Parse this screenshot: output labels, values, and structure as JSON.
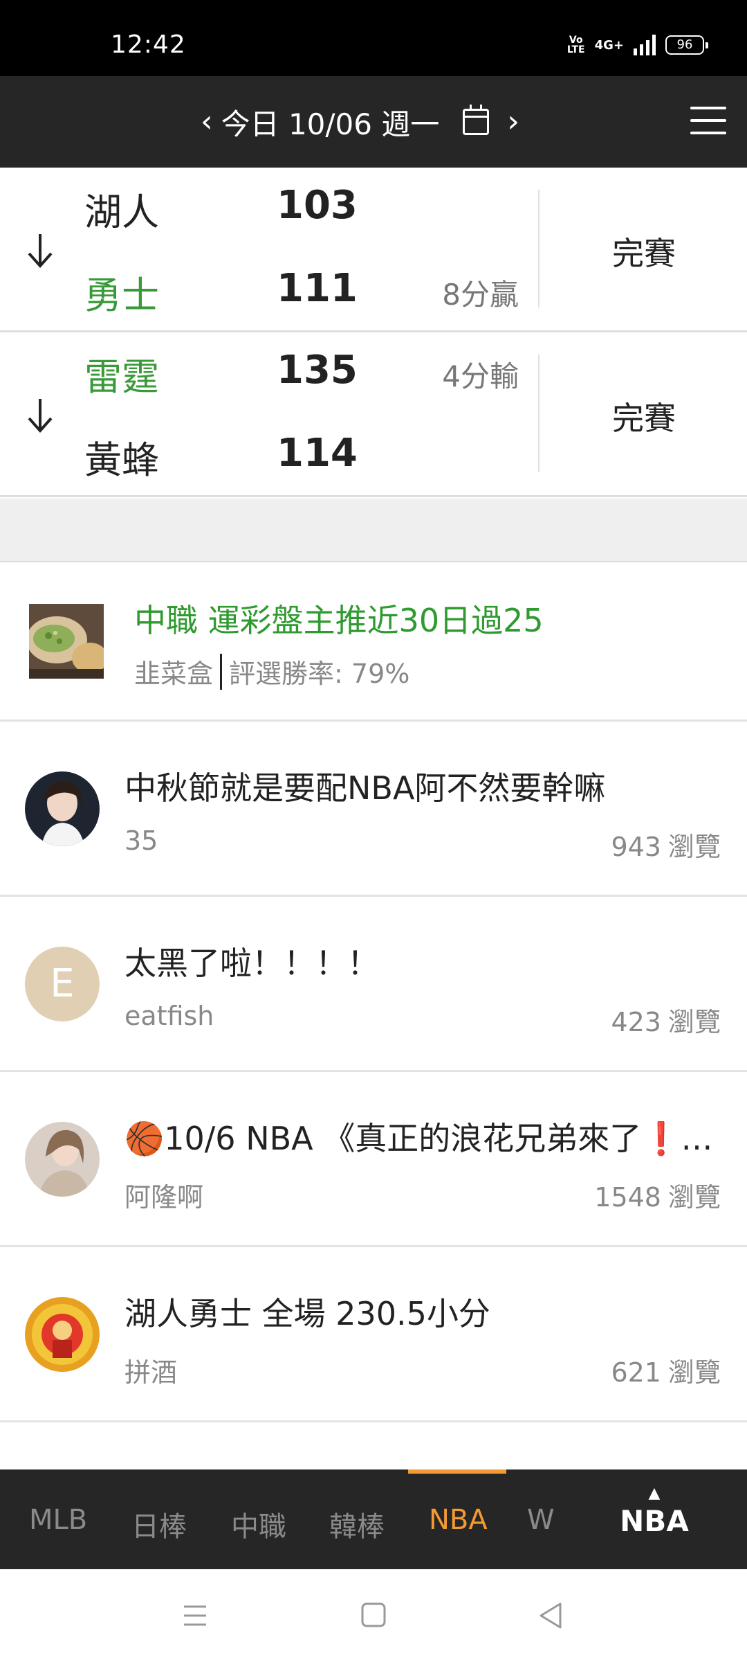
{
  "status_bar": {
    "time": "12:42",
    "volte": "Vo LTE",
    "network": "4G+",
    "battery": "96"
  },
  "date_header": {
    "prev_icon": "chevron-left-icon",
    "label": "今日 10/06 週一",
    "calendar_icon": "calendar-icon",
    "next_icon": "chevron-right-icon",
    "menu_icon": "hamburger-menu-icon"
  },
  "games": [
    {
      "home": {
        "name": "湖人",
        "score": "103",
        "winner": false
      },
      "away": {
        "name": "勇士",
        "score": "111",
        "winner": true
      },
      "margin": "8分贏",
      "status": "完賽"
    },
    {
      "home": {
        "name": "雷霆",
        "score": "135",
        "winner": true
      },
      "away": {
        "name": "黃蜂",
        "score": "114",
        "winner": false
      },
      "margin": "4分輸",
      "status": "完賽"
    }
  ],
  "promo": {
    "title": "中職 運彩盤主推近30日過25",
    "author": "韭菜盒",
    "winrate": "評選勝率: 79%"
  },
  "posts": [
    {
      "title": "中秋節就是要配NBA阿不然要幹嘛",
      "author": "35",
      "views": "943",
      "views_unit": "瀏覽"
    },
    {
      "title": "太黑了啦！！！！",
      "author": "eatfish",
      "views": "423",
      "views_unit": "瀏覽",
      "avatar_letter": "E"
    },
    {
      "title": "🏀10/6 NBA 《真正的浪花兄弟來了❗…",
      "author": "阿隆啊",
      "views": "1548",
      "views_unit": "瀏覽"
    },
    {
      "title": "湖人勇士 全場 230.5小分",
      "author": "拼酒",
      "views": "621",
      "views_unit": "瀏覽"
    }
  ],
  "tabs": [
    "MLB",
    "日棒",
    "中職",
    "韓棒",
    "NBA",
    "W"
  ],
  "active_tab": "NBA",
  "league_selector": {
    "label": "NBA"
  },
  "colors": {
    "win_green": "#3a9a3a",
    "accent_orange": "#f39a33",
    "header_dark": "#262626"
  }
}
